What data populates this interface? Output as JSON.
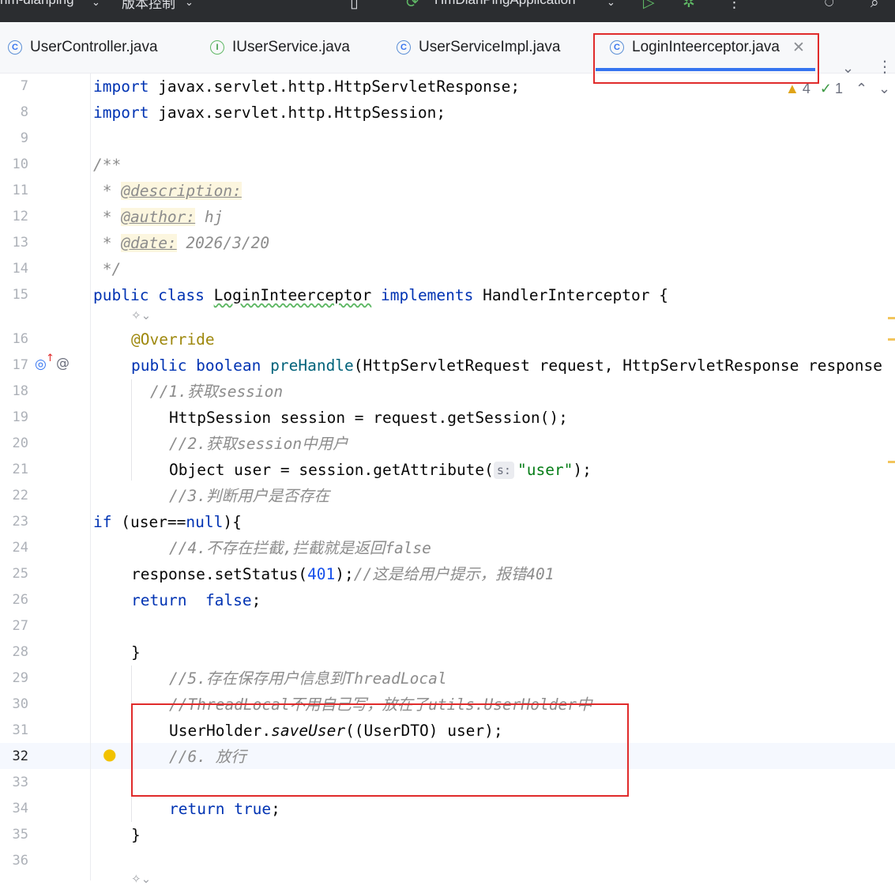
{
  "titlebar": {
    "project": "hm-dianping",
    "vcs": "版本控制",
    "run_config": "HmDianPingApplication"
  },
  "tabs": [
    {
      "label": "UserController.java",
      "icon": "class-icon",
      "active": false
    },
    {
      "label": "IUserService.java",
      "icon": "interface-icon",
      "active": false
    },
    {
      "label": "UserServiceImpl.java",
      "icon": "class-icon",
      "active": false
    },
    {
      "label": "LoginInteerceptor.java",
      "icon": "class-icon",
      "active": true
    }
  ],
  "inspection": {
    "warnings": "4",
    "weak_warnings": "1"
  },
  "editor": {
    "current_line": "32",
    "lines": [
      {
        "n": "7"
      },
      {
        "n": "8"
      },
      {
        "n": "9"
      },
      {
        "n": "10"
      },
      {
        "n": "11"
      },
      {
        "n": "12"
      },
      {
        "n": "13"
      },
      {
        "n": "14"
      },
      {
        "n": "15"
      },
      {
        "n": "16"
      },
      {
        "n": "17"
      },
      {
        "n": "18"
      },
      {
        "n": "19"
      },
      {
        "n": "20"
      },
      {
        "n": "21"
      },
      {
        "n": "22"
      },
      {
        "n": "23"
      },
      {
        "n": "24"
      },
      {
        "n": "25"
      },
      {
        "n": "26"
      },
      {
        "n": "27"
      },
      {
        "n": "28"
      },
      {
        "n": "29"
      },
      {
        "n": "30"
      },
      {
        "n": "31"
      },
      {
        "n": "32"
      },
      {
        "n": "33"
      },
      {
        "n": "34"
      },
      {
        "n": "35"
      },
      {
        "n": "36"
      }
    ],
    "code": {
      "l7_kw": "import",
      "l7_rest": " javax.servlet.http.HttpServletResponse;",
      "l8_kw": "import",
      "l8_rest": " javax.servlet.http.HttpSession;",
      "l10": "/**",
      "l11_star": " * ",
      "l11_tag": "@description:",
      "l12_star": " * ",
      "l12_tag": "@author:",
      "l12_val": " hj",
      "l13_star": " * ",
      "l13_tag": "@date:",
      "l13_val": " 2026/3/20",
      "l14": " */",
      "l15_kw1": "public class",
      "l15_name": "LoginInteerceptor",
      "l15_kw2": "implements",
      "l15_iface": "HandlerInterceptor {",
      "l16": "@Override",
      "l17_kw": "public boolean",
      "l17_fn": "preHandle",
      "l17_rest": "(HttpServletRequest request, HttpServletResponse response",
      "l18": "//1.获取session",
      "l19": "HttpSession session = request.getSession();",
      "l20": "//2.获取session中用户",
      "l21_a": "Object user = session.getAttribute(",
      "l21_hint": "s:",
      "l21_str": "\"user\"",
      "l21_b": ");",
      "l22": "//3.判断用户是否存在",
      "l23_kw": "if",
      "l23_a": " (user==",
      "l23_null": "null",
      "l23_b": "){",
      "l24": "//4.不存在拦截,拦截就是返回false",
      "l25_a": "response.setStatus(",
      "l25_num": "401",
      "l25_b": ");",
      "l25_cm": "//这是给用户提示，报错401",
      "l26_kw": "return",
      "l26_val": "false",
      "l26_semi": ";",
      "l28": "}",
      "l29": "//5.存在保存用户信息到ThreadLocal",
      "l30": "//ThreadLocal不用自己写，放在了utils.UserHolder中",
      "l31_a": "UserHolder.",
      "l31_fn": "saveUser",
      "l31_b": "((UserDTO) user);",
      "l32": "//6. 放行",
      "l34_kw": "return",
      "l34_val": "true",
      "l34_semi": ";",
      "l35": "}"
    }
  },
  "colors": {
    "highlight_box": "#e02b2b",
    "accent": "#3574f0"
  }
}
